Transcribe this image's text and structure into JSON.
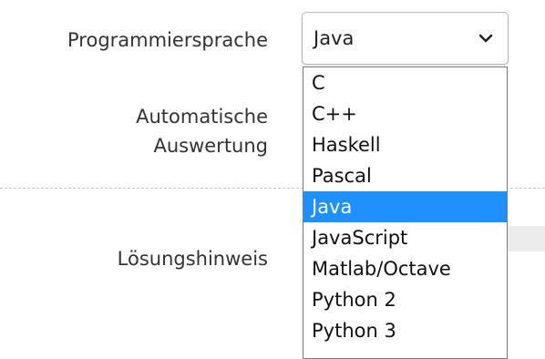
{
  "form": {
    "language_label": "Programmiersprache",
    "auto_eval_label_line1": "Automatische",
    "auto_eval_label_line2": "Auswertung",
    "solution_hint_label": "Lösungshinweis"
  },
  "language_select": {
    "selected": "Java",
    "expanded": true,
    "options": [
      "C",
      "C++",
      "Haskell",
      "Pascal",
      "Java",
      "JavaScript",
      "Matlab/Octave",
      "Python 2",
      "Python 3"
    ],
    "highlighted_index": 4,
    "highlight_color": "#1e90ff",
    "icon": "chevron-down-icon"
  },
  "colors": {
    "label_text": "#333333",
    "divider": "#c8c8c8"
  }
}
